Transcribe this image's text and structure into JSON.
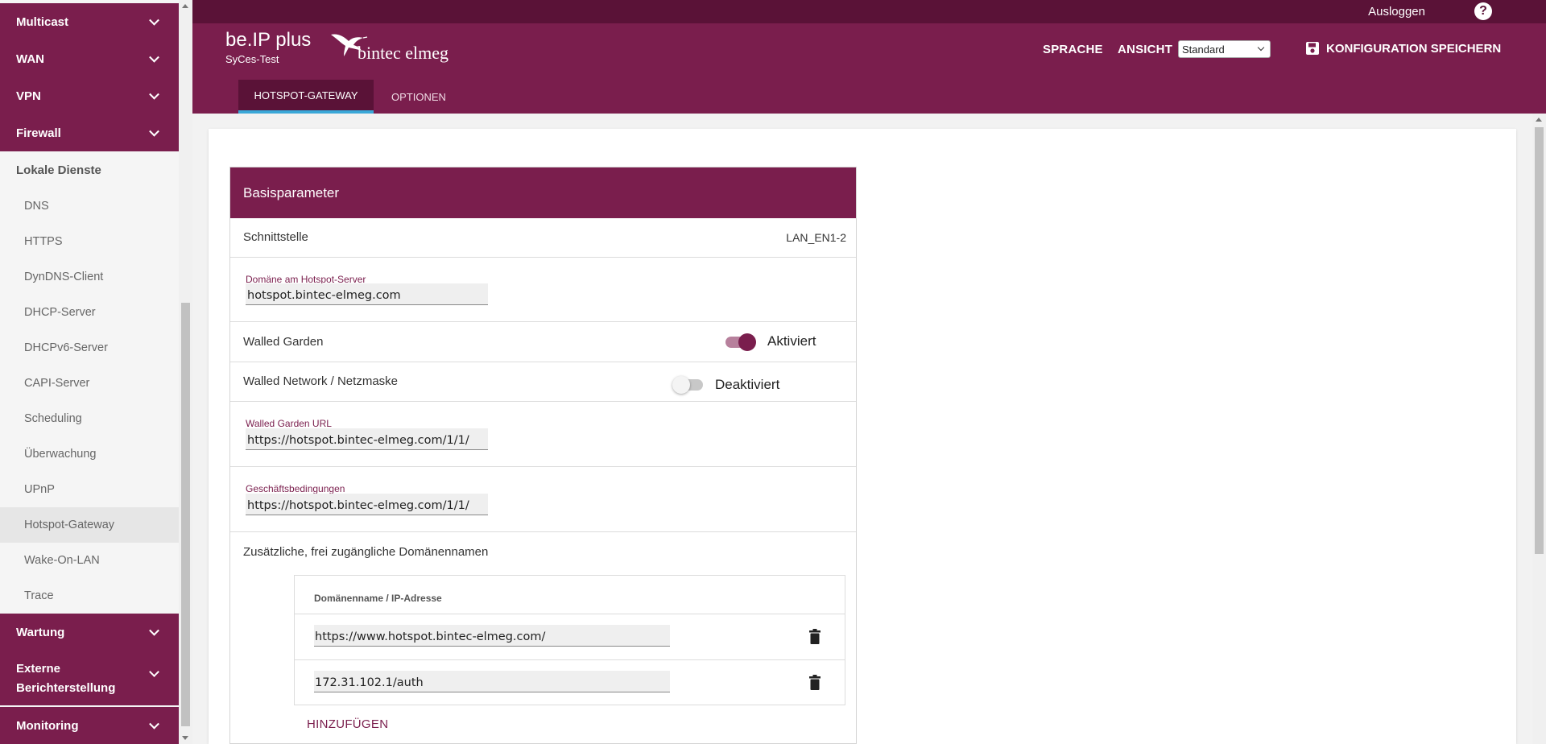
{
  "sidebar": {
    "sections_top": [
      {
        "label": "Multicast"
      },
      {
        "label": "WAN"
      },
      {
        "label": "VPN"
      },
      {
        "label": "Firewall"
      }
    ],
    "group_label": "Lokale Dienste",
    "items": [
      {
        "label": "DNS"
      },
      {
        "label": "HTTPS"
      },
      {
        "label": "DynDNS-Client"
      },
      {
        "label": "DHCP-Server"
      },
      {
        "label": "DHCPv6-Server"
      },
      {
        "label": "CAPI-Server"
      },
      {
        "label": "Scheduling"
      },
      {
        "label": "Überwachung"
      },
      {
        "label": "UPnP"
      },
      {
        "label": "Hotspot-Gateway",
        "active": true
      },
      {
        "label": "Wake-On-LAN"
      },
      {
        "label": "Trace"
      }
    ],
    "sections_bottom": [
      {
        "label": "Wartung"
      },
      {
        "label": "Externe Berichterstellung"
      },
      {
        "label": "Monitoring"
      }
    ]
  },
  "topbar": {
    "logout_label": "Ausloggen",
    "help_icon": "?"
  },
  "header": {
    "brand": "be.IP plus",
    "device_name": "SyCes-Test",
    "logo_text": "bintec elmeg",
    "language_label": "SPRACHE",
    "view_label": "ANSICHT",
    "view_selected": "Standard",
    "save_label": "KONFIGURATION SPEICHERN",
    "tabs": [
      {
        "label": "HOTSPOT-GATEWAY",
        "active": true
      },
      {
        "label": "OPTIONEN"
      }
    ]
  },
  "panel": {
    "title": "Basisparameter",
    "interface_label": "Schnittstelle",
    "interface_value": "LAN_EN1-2",
    "domain_label": "Domäne am Hotspot-Server",
    "domain_value": "hotspot.bintec-elmeg.com",
    "walled_garden_label": "Walled Garden",
    "walled_garden_state": "Aktiviert",
    "walled_network_label": "Walled Network / Netzmaske",
    "walled_network_state": "Deaktiviert",
    "walled_garden_url_label": "Walled Garden URL",
    "walled_garden_url_value": "https://hotspot.bintec-elmeg.com/1/1/",
    "terms_label": "Geschäftsbedingungen",
    "terms_value": "https://hotspot.bintec-elmeg.com/1/1/",
    "extra_domains_label": "Zusätzliche, frei zugängliche Domänennamen",
    "table_header": "Domänenname / IP-Adresse",
    "table_rows": [
      {
        "value": "https://www.hotspot.bintec-elmeg.com/"
      },
      {
        "value": "172.31.102.1/auth"
      }
    ],
    "add_label": "HINZUFÜGEN"
  },
  "colors": {
    "brand": "#7a1e4d",
    "topbar": "#5a1237",
    "tab_indicator": "#3aa8d8"
  }
}
